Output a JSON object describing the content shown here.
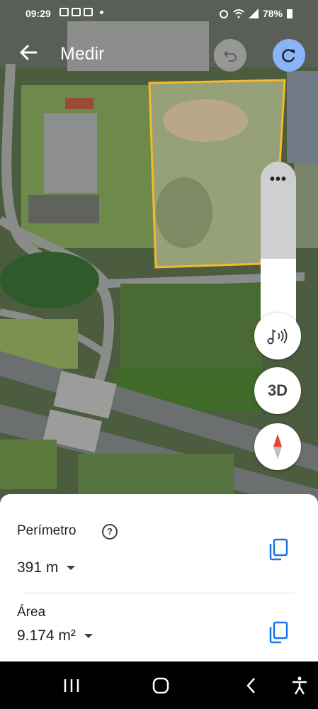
{
  "status_bar": {
    "time": "09:29",
    "battery": "78%",
    "notification_icons": [
      "youtube-icon",
      "youtube-icon",
      "gallery-icon",
      "dot-icon"
    ],
    "system_icons": [
      "alarm-icon",
      "wifi-icon",
      "signal-icon",
      "battery-icon"
    ]
  },
  "header": {
    "title": "Medir",
    "back_icon": "arrow-left-icon",
    "undo_icon": "undo-icon",
    "redo_icon": "redo-icon"
  },
  "map_controls": {
    "zoom_menu_label": "•••",
    "audio_icon": "music-waves-icon",
    "three_d_label": "3D",
    "compass_icon": "compass-icon"
  },
  "measurement": {
    "perimeter_label": "Perímetro",
    "perimeter_value": "391 m",
    "area_label": "Área",
    "area_value": "9.174 m²",
    "help_symbol": "?",
    "copy_icon": "copy-icon"
  },
  "nav_bar": {
    "items": [
      "recents-icon",
      "home-icon",
      "back-icon",
      "accessibility-icon"
    ]
  },
  "colors": {
    "polygon_outline": "#f5b82e",
    "accent_blue": "#1a73e8",
    "redo_button": "#8ab4f8"
  }
}
